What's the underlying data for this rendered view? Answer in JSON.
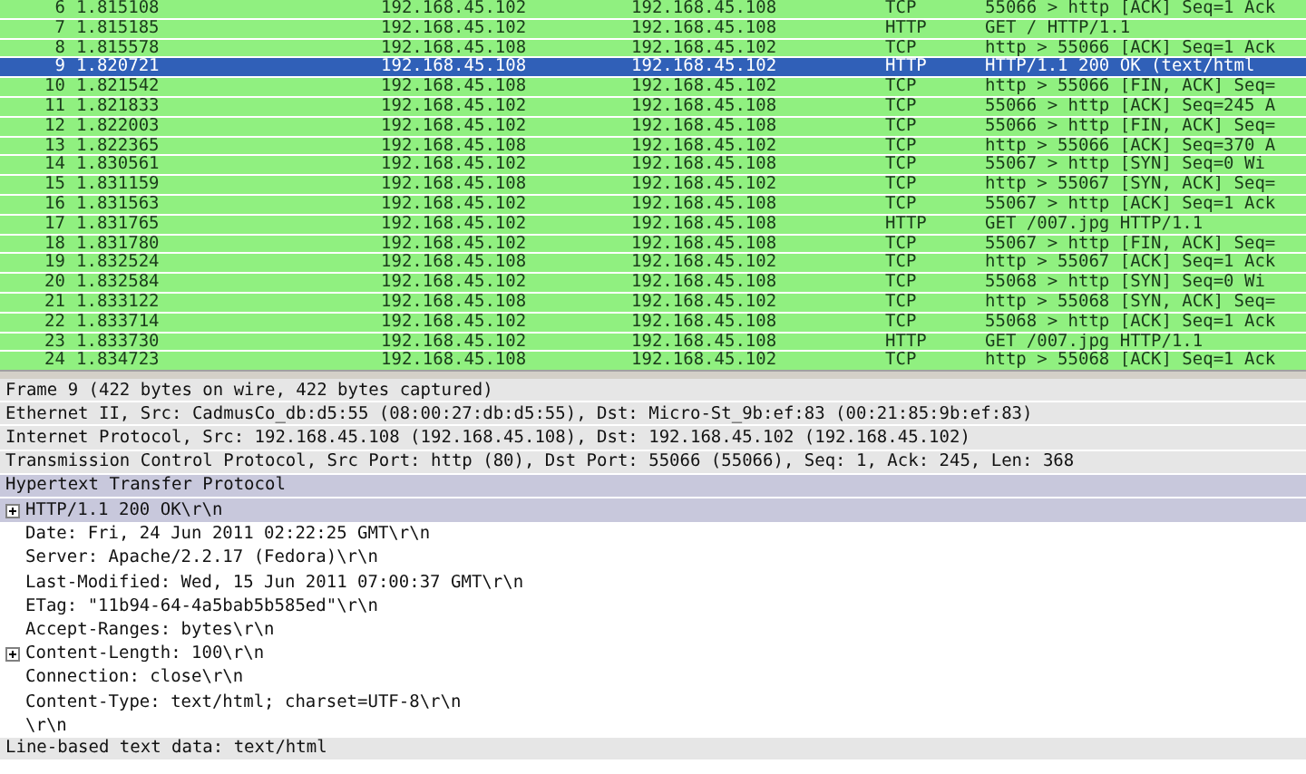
{
  "packet_list": {
    "rows": [
      {
        "no": "6",
        "time": "1.815108",
        "source": "192.168.45.102",
        "destination": "192.168.45.108",
        "protocol": "TCP",
        "info": "55066 > http [ACK] Seq=1 Ack",
        "selected": false
      },
      {
        "no": "7",
        "time": "1.815185",
        "source": "192.168.45.102",
        "destination": "192.168.45.108",
        "protocol": "HTTP",
        "info": "GET / HTTP/1.1",
        "selected": false
      },
      {
        "no": "8",
        "time": "1.815578",
        "source": "192.168.45.108",
        "destination": "192.168.45.102",
        "protocol": "TCP",
        "info": "http > 55066 [ACK] Seq=1 Ack",
        "selected": false
      },
      {
        "no": "9",
        "time": "1.820721",
        "source": "192.168.45.108",
        "destination": "192.168.45.102",
        "protocol": "HTTP",
        "info": "HTTP/1.1 200 OK  (text/html",
        "selected": true
      },
      {
        "no": "10",
        "time": "1.821542",
        "source": "192.168.45.108",
        "destination": "192.168.45.102",
        "protocol": "TCP",
        "info": "http > 55066 [FIN, ACK] Seq=",
        "selected": false
      },
      {
        "no": "11",
        "time": "1.821833",
        "source": "192.168.45.102",
        "destination": "192.168.45.108",
        "protocol": "TCP",
        "info": "55066 > http [ACK] Seq=245 A",
        "selected": false
      },
      {
        "no": "12",
        "time": "1.822003",
        "source": "192.168.45.102",
        "destination": "192.168.45.108",
        "protocol": "TCP",
        "info": "55066 > http [FIN, ACK] Seq=",
        "selected": false
      },
      {
        "no": "13",
        "time": "1.822365",
        "source": "192.168.45.108",
        "destination": "192.168.45.102",
        "protocol": "TCP",
        "info": "http > 55066 [ACK] Seq=370 A",
        "selected": false
      },
      {
        "no": "14",
        "time": "1.830561",
        "source": "192.168.45.102",
        "destination": "192.168.45.108",
        "protocol": "TCP",
        "info": "55067 > http [SYN] Seq=0 Wi",
        "selected": false
      },
      {
        "no": "15",
        "time": "1.831159",
        "source": "192.168.45.108",
        "destination": "192.168.45.102",
        "protocol": "TCP",
        "info": "http > 55067 [SYN, ACK] Seq=",
        "selected": false
      },
      {
        "no": "16",
        "time": "1.831563",
        "source": "192.168.45.102",
        "destination": "192.168.45.108",
        "protocol": "TCP",
        "info": "55067 > http [ACK] Seq=1 Ack",
        "selected": false
      },
      {
        "no": "17",
        "time": "1.831765",
        "source": "192.168.45.102",
        "destination": "192.168.45.108",
        "protocol": "HTTP",
        "info": "GET /007.jpg HTTP/1.1",
        "selected": false
      },
      {
        "no": "18",
        "time": "1.831780",
        "source": "192.168.45.102",
        "destination": "192.168.45.108",
        "protocol": "TCP",
        "info": "55067 > http [FIN, ACK] Seq=",
        "selected": false
      },
      {
        "no": "19",
        "time": "1.832524",
        "source": "192.168.45.108",
        "destination": "192.168.45.102",
        "protocol": "TCP",
        "info": "http > 55067 [ACK] Seq=1 Ack",
        "selected": false
      },
      {
        "no": "20",
        "time": "1.832584",
        "source": "192.168.45.102",
        "destination": "192.168.45.108",
        "protocol": "TCP",
        "info": "55068 > http [SYN] Seq=0 Wi",
        "selected": false
      },
      {
        "no": "21",
        "time": "1.833122",
        "source": "192.168.45.108",
        "destination": "192.168.45.102",
        "protocol": "TCP",
        "info": "http > 55068 [SYN, ACK] Seq=",
        "selected": false
      },
      {
        "no": "22",
        "time": "1.833714",
        "source": "192.168.45.102",
        "destination": "192.168.45.108",
        "protocol": "TCP",
        "info": "55068 > http [ACK] Seq=1 Ack",
        "selected": false
      },
      {
        "no": "23",
        "time": "1.833730",
        "source": "192.168.45.102",
        "destination": "192.168.45.108",
        "protocol": "HTTP",
        "info": "GET /007.jpg HTTP/1.1",
        "selected": false
      },
      {
        "no": "24",
        "time": "1.834723",
        "source": "192.168.45.108",
        "destination": "192.168.45.102",
        "protocol": "TCP",
        "info": "http > 55068 [ACK] Seq=1 Ack",
        "selected": false
      }
    ]
  },
  "packet_details": {
    "items": [
      {
        "text": "Frame 9 (422 bytes on wire, 422 bytes captured)",
        "selected": false
      },
      {
        "text": "Ethernet II, Src: CadmusCo_db:d5:55 (08:00:27:db:d5:55), Dst: Micro-St_9b:ef:83 (00:21:85:9b:ef:83)",
        "selected": false
      },
      {
        "text": "Internet Protocol, Src: 192.168.45.108 (192.168.45.108), Dst: 192.168.45.102 (192.168.45.102)",
        "selected": false
      },
      {
        "text": "Transmission Control Protocol, Src Port: http (80), Dst Port: 55066 (55066), Seq: 1, Ack: 245, Len: 368",
        "selected": false
      },
      {
        "text": "Hypertext Transfer Protocol",
        "selected": true,
        "children": [
          {
            "text": "HTTP/1.1 200 OK\\r\\n",
            "selected": true,
            "expanded": false
          },
          {
            "text": "Date: Fri, 24 Jun 2011 02:22:25 GMT\\r\\n",
            "selected": false
          },
          {
            "text": "Server: Apache/2.2.17 (Fedora)\\r\\n",
            "selected": false
          },
          {
            "text": "Last-Modified: Wed, 15 Jun 2011 07:00:37 GMT\\r\\n",
            "selected": false
          },
          {
            "text": "ETag: \"11b94-64-4a5bab5b585ed\"\\r\\n",
            "selected": false
          },
          {
            "text": "Accept-Ranges: bytes\\r\\n",
            "selected": false
          },
          {
            "text": "Content-Length: 100\\r\\n",
            "selected": false,
            "expanded": false
          },
          {
            "text": "Connection: close\\r\\n",
            "selected": false
          },
          {
            "text": "Content-Type: text/html; charset=UTF-8\\r\\n",
            "selected": false
          },
          {
            "text": "\\r\\n",
            "selected": false
          }
        ]
      },
      {
        "text": "Line-based text data: text/html",
        "selected": false
      }
    ]
  }
}
